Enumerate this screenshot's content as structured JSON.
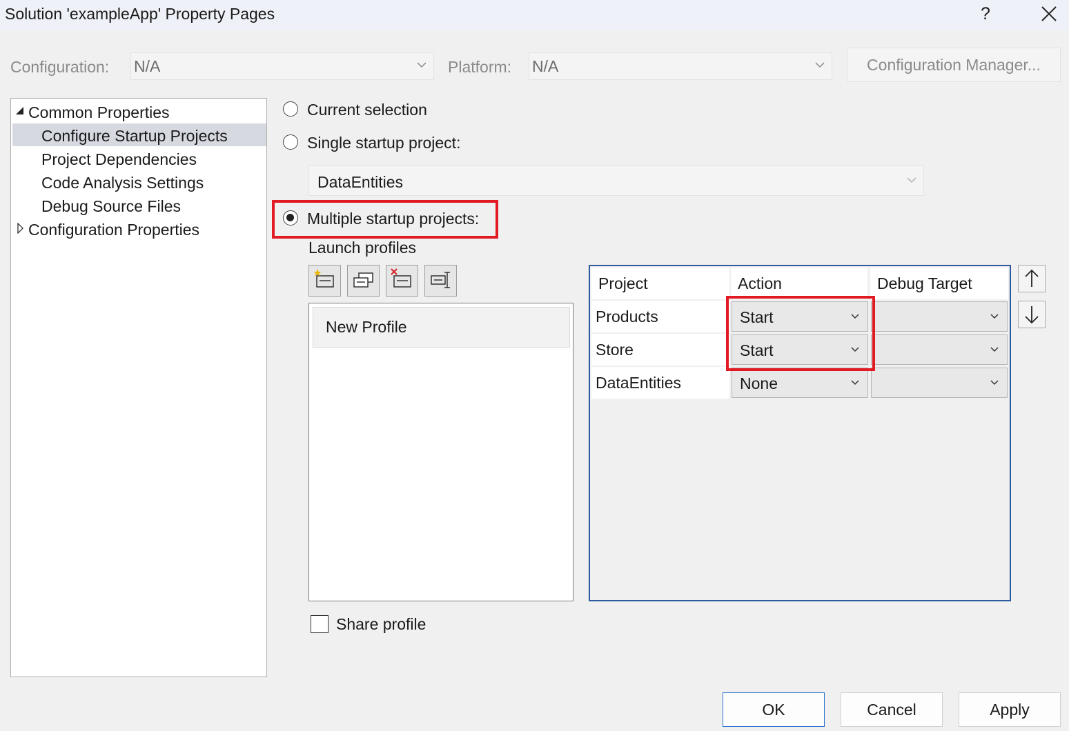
{
  "window": {
    "title": "Solution 'exampleApp' Property Pages",
    "help_label": "?"
  },
  "config_row": {
    "configuration_label": "Configuration:",
    "configuration_value": "N/A",
    "platform_label": "Platform:",
    "platform_value": "N/A",
    "manager_button": "Configuration Manager..."
  },
  "tree": {
    "common_properties": "Common Properties",
    "items": [
      "Configure Startup Projects",
      "Project Dependencies",
      "Code Analysis Settings",
      "Debug Source Files"
    ],
    "configuration_properties": "Configuration Properties",
    "selected_index": 0
  },
  "startup": {
    "current_selection": "Current selection",
    "single_startup": "Single startup project:",
    "single_project_value": "DataEntities",
    "multiple_startup": "Multiple startup projects:",
    "selected_option": "multiple"
  },
  "launch_profiles": {
    "label": "Launch profiles",
    "toolbar_icons": [
      "new-profile-icon",
      "copy-profile-icon",
      "delete-profile-icon",
      "rename-profile-icon"
    ],
    "profiles": [
      "New Profile"
    ],
    "share_profile_label": "Share profile",
    "share_profile_checked": false
  },
  "grid": {
    "columns": [
      "Project",
      "Action",
      "Debug Target"
    ],
    "rows": [
      {
        "project": "Products",
        "action": "Start",
        "debug_target": ""
      },
      {
        "project": "Store",
        "action": "Start",
        "debug_target": ""
      },
      {
        "project": "DataEntities",
        "action": "None",
        "debug_target": ""
      }
    ]
  },
  "buttons": {
    "ok": "OK",
    "cancel": "Cancel",
    "apply": "Apply"
  },
  "colors": {
    "highlight_red": "#e21a23",
    "grid_border_blue": "#2c5aa0",
    "ok_border_blue": "#2c6fcf"
  }
}
